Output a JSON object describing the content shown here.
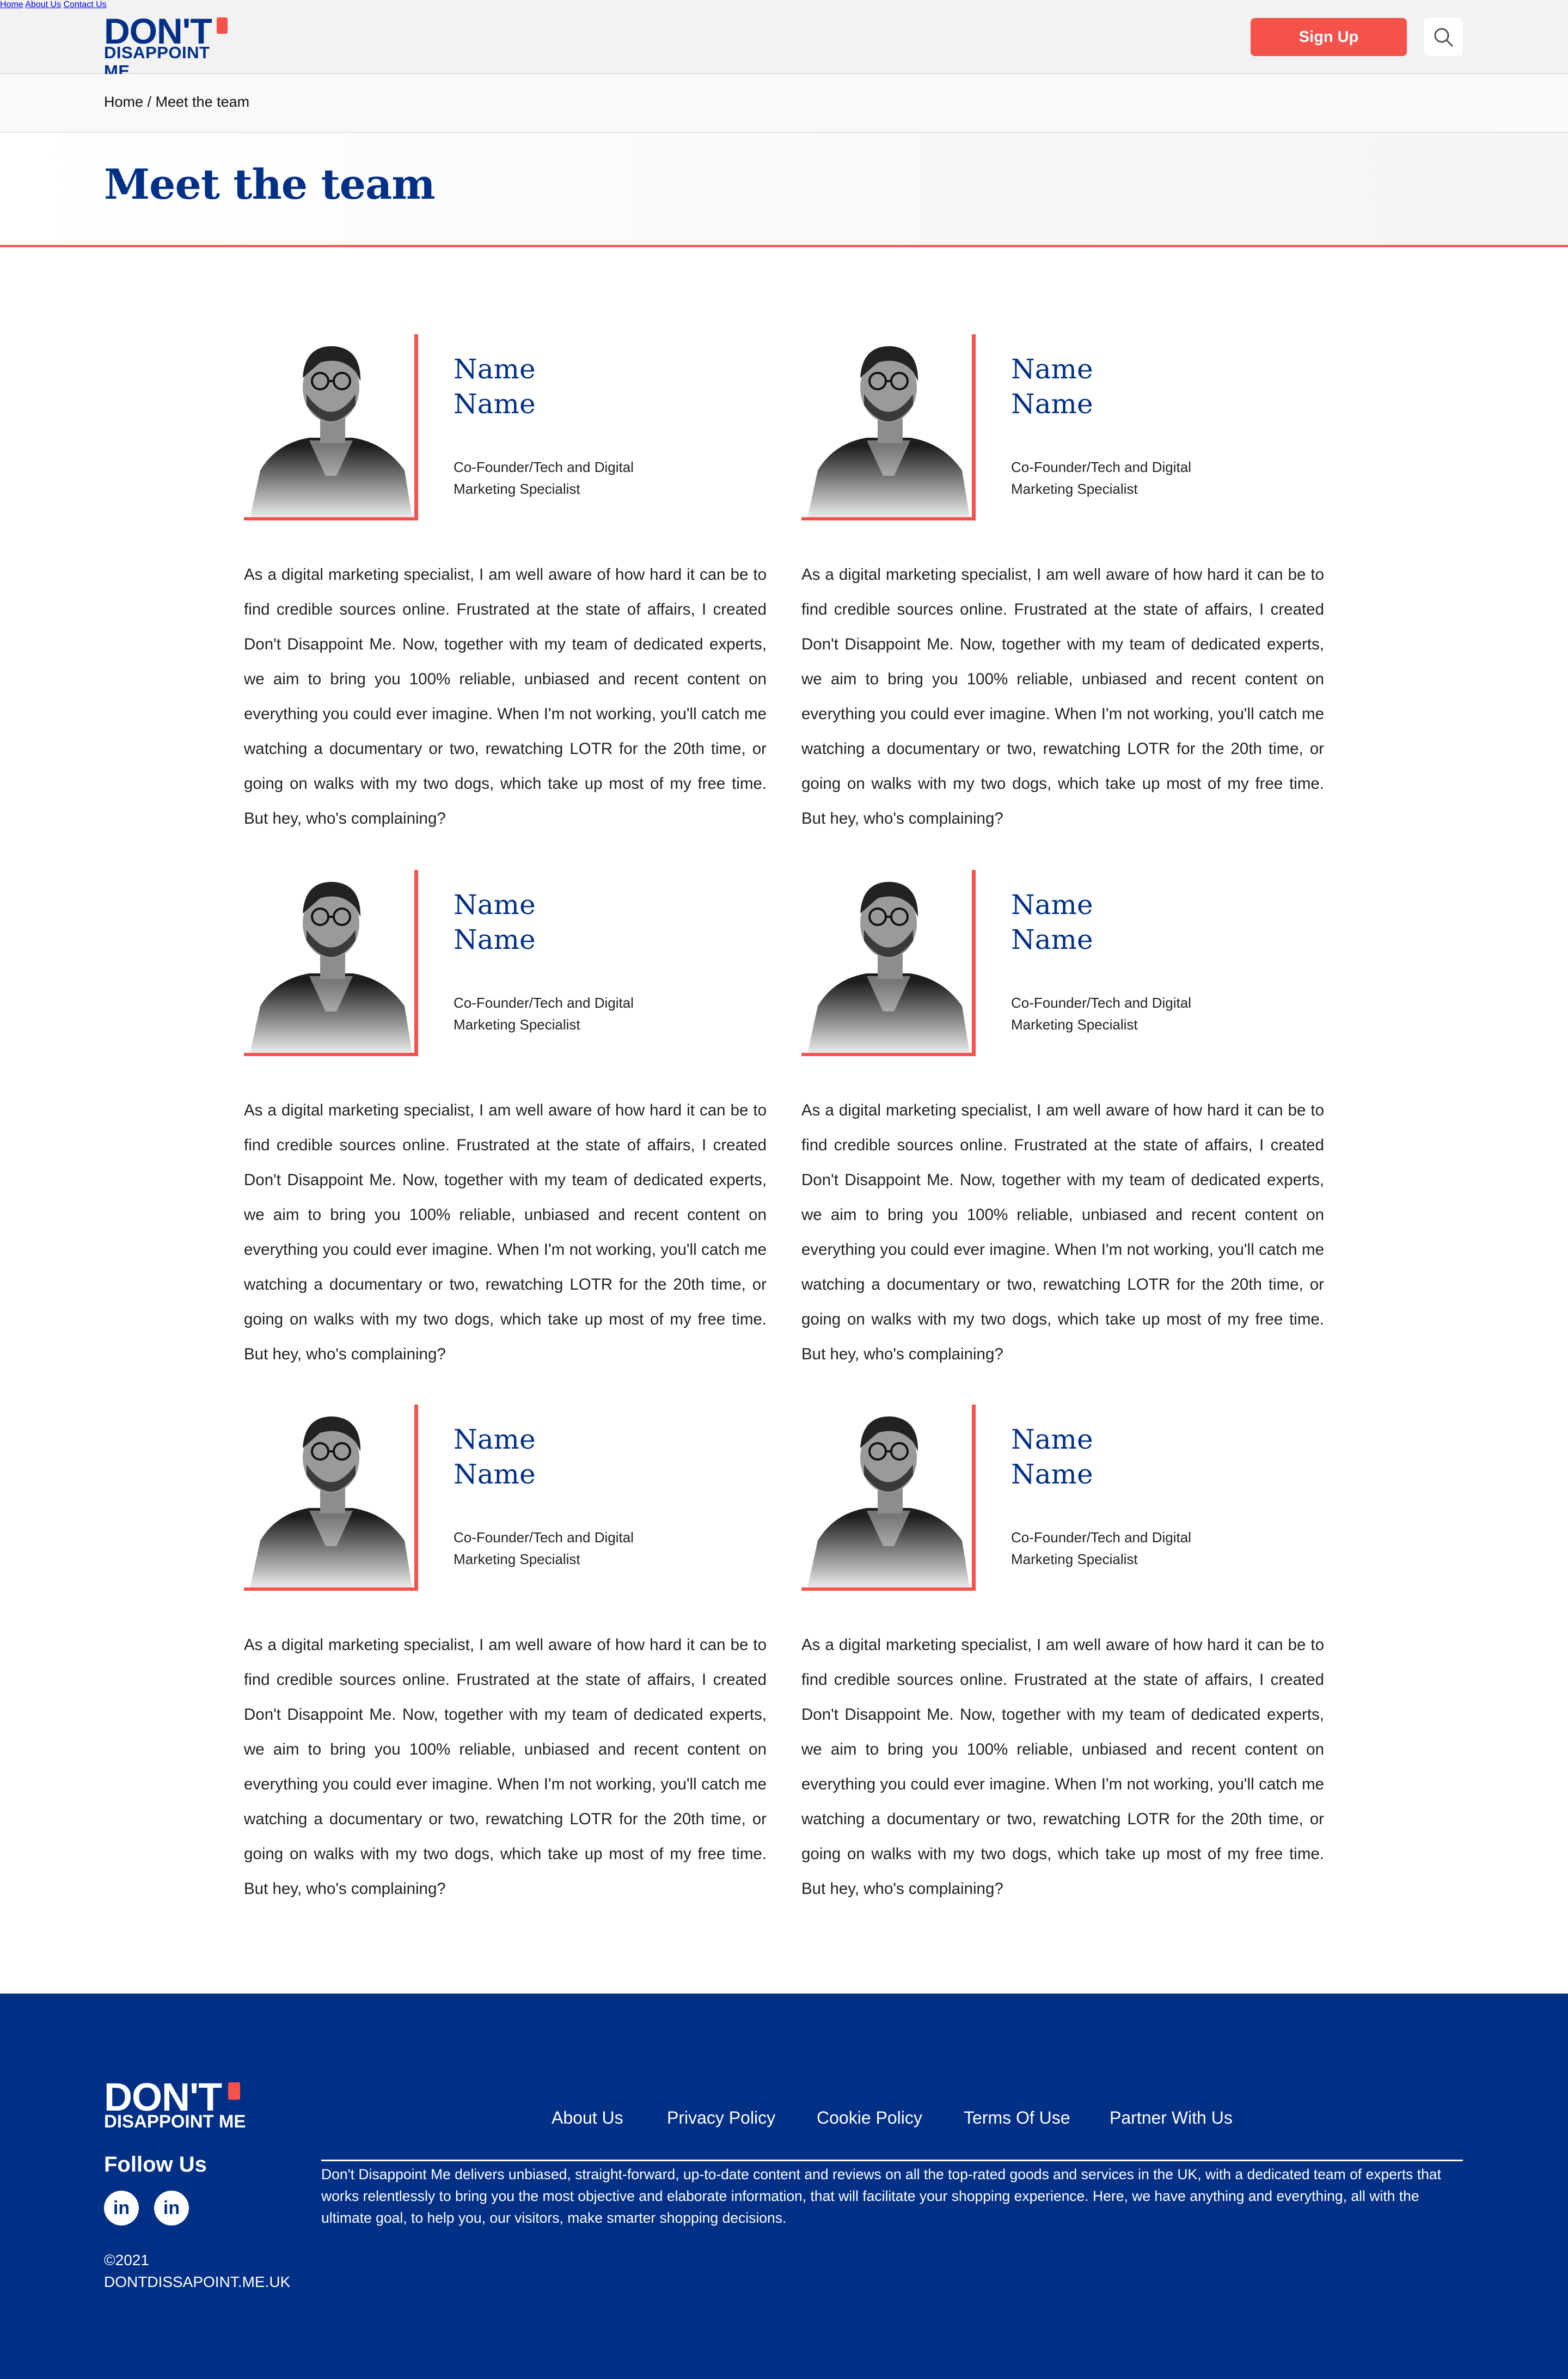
{
  "header": {
    "logo_top": "DON'T",
    "logo_bottom": "DISAPPOINT ME",
    "nav": [
      "Home",
      "About Us",
      "Contact Us"
    ],
    "signup_label": "Sign Up",
    "search_icon": "search-icon"
  },
  "breadcrumb": "Home / Meet the team",
  "page_title": "Meet the team",
  "members": [
    {
      "name_line1": "Name",
      "name_line2": "Name",
      "role_line1": "Co-Founder/Tech and Digital",
      "role_line2": "Marketing Specialist",
      "bio": "As a digital marketing specialist, I am well aware of how hard it can be to find credible sources online. Frustrated at the state of affairs, I created Don't Disappoint Me. Now, together with my team of dedicated experts, we aim to bring you 100% reliable, unbiased and recent content on everything you could ever imagine. When I'm not working, you'll catch me watching a documentary or two, rewatching LOTR for the 20th time, or going on walks with my two dogs, which take up most of my free time. But hey, who's complaining?"
    },
    {
      "name_line1": "Name",
      "name_line2": "Name",
      "role_line1": "Co-Founder/Tech and Digital",
      "role_line2": "Marketing Specialist",
      "bio": "As a digital marketing specialist, I am well aware of how hard it can be to find credible sources online. Frustrated at the state of affairs, I created Don't Disappoint Me. Now, together with my team of dedicated experts, we aim to bring you 100% reliable, unbiased and recent content on everything you could ever imagine. When I'm not working, you'll catch me watching a documentary or two, rewatching LOTR for the 20th time, or going on walks with my two dogs, which take up most of my free time. But hey, who's complaining?"
    },
    {
      "name_line1": "Name",
      "name_line2": "Name",
      "role_line1": "Co-Founder/Tech and Digital",
      "role_line2": "Marketing Specialist",
      "bio": "As a digital marketing specialist, I am well aware of how hard it can be to find credible sources online. Frustrated at the state of affairs, I created Don't Disappoint Me. Now, together with my team of dedicated experts, we aim to bring you 100% reliable, unbiased and recent content on everything you could ever imagine. When I'm not working, you'll catch me watching a documentary or two, rewatching LOTR for the 20th time, or going on walks with my two dogs, which take up most of my free time. But hey, who's complaining?"
    },
    {
      "name_line1": "Name",
      "name_line2": "Name",
      "role_line1": "Co-Founder/Tech and Digital",
      "role_line2": "Marketing Specialist",
      "bio": "As a digital marketing specialist, I am well aware of how hard it can be to find credible sources online. Frustrated at the state of affairs, I created Don't Disappoint Me. Now, together with my team of dedicated experts, we aim to bring you 100% reliable, unbiased and recent content on everything you could ever imagine. When I'm not working, you'll catch me watching a documentary or two, rewatching LOTR for the 20th time, or going on walks with my two dogs, which take up most of my free time. But hey, who's complaining?"
    },
    {
      "name_line1": "Name",
      "name_line2": "Name",
      "role_line1": "Co-Founder/Tech and Digital",
      "role_line2": "Marketing Specialist",
      "bio": "As a digital marketing specialist, I am well aware of how hard it can be to find credible sources online. Frustrated at the state of affairs, I created Don't Disappoint Me. Now, together with my team of dedicated experts, we aim to bring you 100% reliable, unbiased and recent content on everything you could ever imagine. When I'm not working, you'll catch me watching a documentary or two, rewatching LOTR for the 20th time, or going on walks with my two dogs, which take up most of my free time. But hey, who's complaining?"
    },
    {
      "name_line1": "Name",
      "name_line2": "Name",
      "role_line1": "Co-Founder/Tech and Digital",
      "role_line2": "Marketing Specialist",
      "bio": "As a digital marketing specialist, I am well aware of how hard it can be to find credible sources online. Frustrated at the state of affairs, I created Don't Disappoint Me. Now, together with my team of dedicated experts, we aim to bring you 100% reliable, unbiased and recent content on everything you could ever imagine. When I'm not working, you'll catch me watching a documentary or two, rewatching LOTR for the 20th time, or going on walks with my two dogs, which take up most of my free time. But hey, who's complaining?"
    }
  ],
  "footer": {
    "logo_top": "DON'T",
    "logo_bottom": "DISAPPOINT ME",
    "follow_us": "Follow Us",
    "social": [
      "in",
      "in"
    ],
    "copyright_line1": "©2021",
    "copyright_line2": "DONTDISSAPOINT.ME.UK",
    "links": [
      "About Us",
      "Privacy Policy",
      "Cookie Policy",
      "Terms Of Use",
      "Partner With Us"
    ],
    "description": "Don't Disappoint Me delivers unbiased, straight-forward, up-to-date content and reviews on all the top-rated goods and services in the UK, with a dedicated team of experts that works relentlessly to bring you the most objective and elaborate information, that will facilitate your shopping experience. Here, we have anything and everything, all with the ultimate goal, to help you, our visitors, make smarter shopping decisions."
  },
  "colors": {
    "brand_blue": "#002f86",
    "accent_red": "#f4524b"
  }
}
